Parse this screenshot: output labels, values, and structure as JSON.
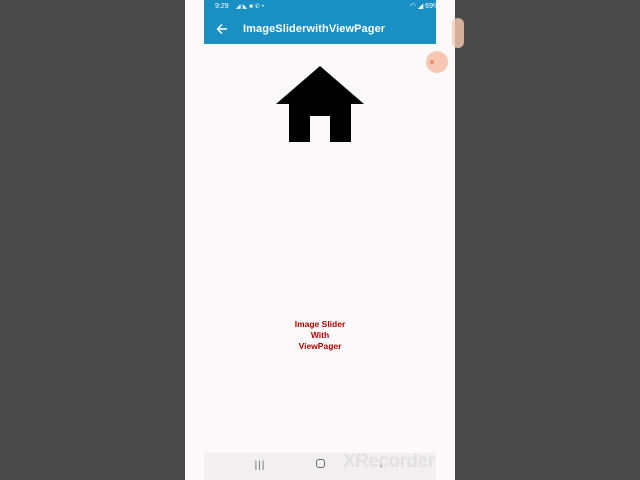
{
  "status_bar": {
    "time": "9:29",
    "left_icons": [
      "telegram-icon",
      "send-icon",
      "video-icon",
      "phone-icon",
      "dot-icon"
    ],
    "battery": "69%",
    "right_icons": [
      "wifi-icon",
      "signal-icon",
      "battery-icon"
    ]
  },
  "app_bar": {
    "title": "ImageSliderwithViewPager",
    "back_icon": "arrow-left-icon",
    "color": "#1a8fc4"
  },
  "slider": {
    "image_icon": "home-icon",
    "caption_lines": [
      "Image Slider",
      "With",
      "ViewPager"
    ],
    "caption_color": "#b00000"
  },
  "nav_bar": {
    "recents": "|||",
    "home": "home-button",
    "back": "‹"
  },
  "watermark": "XRecorder"
}
